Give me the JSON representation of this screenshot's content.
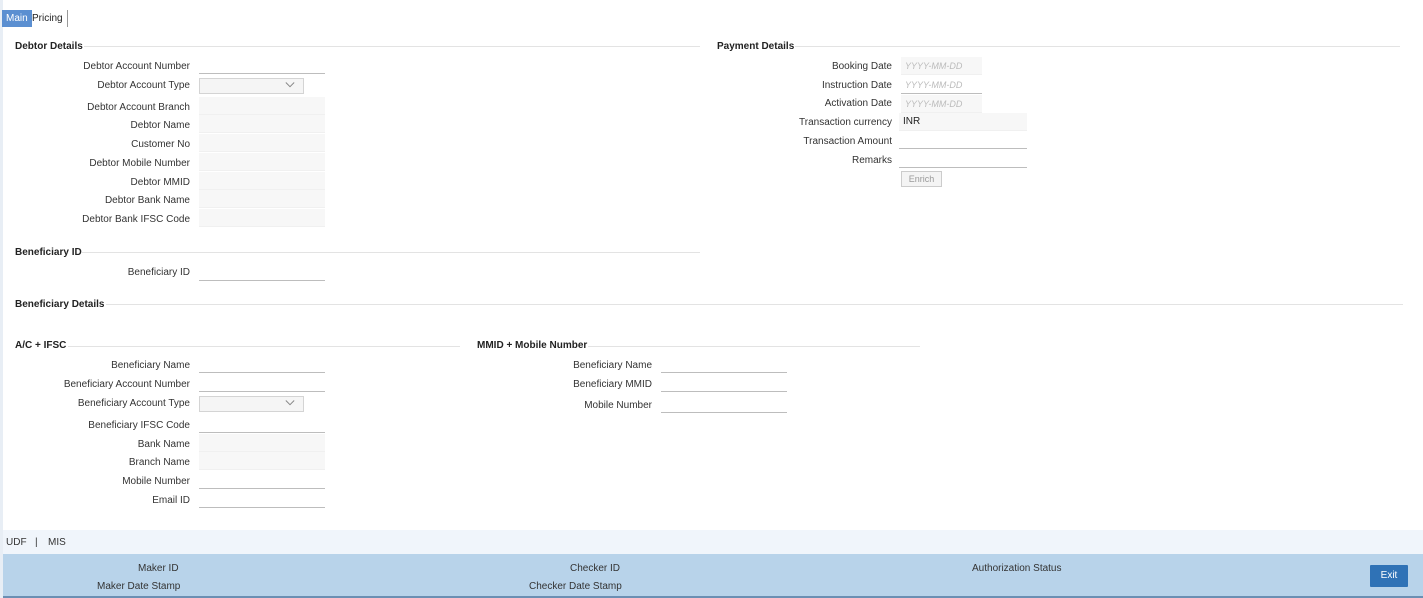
{
  "tabs": {
    "main": "Main",
    "pricing": "Pricing"
  },
  "debtor": {
    "title": "Debtor Details",
    "account_number": "Debtor Account Number",
    "account_type": "Debtor Account Type",
    "account_branch": "Debtor Account Branch",
    "name": "Debtor Name",
    "customer_no": "Customer No",
    "mobile": "Debtor Mobile Number",
    "mmid": "Debtor MMID",
    "bank_name": "Debtor Bank Name",
    "ifsc": "Debtor Bank IFSC Code"
  },
  "payment": {
    "title": "Payment Details",
    "booking_date": "Booking Date",
    "instruction_date": "Instruction Date",
    "activation_date": "Activation Date",
    "currency": "Transaction currency",
    "currency_value": "INR",
    "amount": "Transaction Amount",
    "remarks": "Remarks",
    "date_placeholder": "YYYY-MM-DD",
    "enrich": "Enrich"
  },
  "beneficiary_id": {
    "title": "Beneficiary ID",
    "label": "Beneficiary ID"
  },
  "beneficiary_details": {
    "title": "Beneficiary Details"
  },
  "acifsc": {
    "title": "A/C + IFSC",
    "name": "Beneficiary Name",
    "account_number": "Beneficiary Account Number",
    "account_type": "Beneficiary Account Type",
    "ifsc": "Beneficiary IFSC Code",
    "bank_name": "Bank Name",
    "branch_name": "Branch Name",
    "mobile": "Mobile Number",
    "email": "Email ID"
  },
  "mmid": {
    "title": "MMID + Mobile Number",
    "name": "Beneficiary Name",
    "mmid": "Beneficiary MMID",
    "mobile": "Mobile Number"
  },
  "bottom": {
    "udf": "UDF",
    "separator": "|",
    "mis": "MIS"
  },
  "footer": {
    "maker_id": "Maker ID",
    "maker_date": "Maker Date Stamp",
    "checker_id": "Checker ID",
    "checker_date": "Checker Date Stamp",
    "auth_status": "Authorization Status",
    "exit": "Exit"
  },
  "colors": {
    "accent": "#5b8fd1",
    "footer": "#b8d3ea",
    "exit": "#2f72b6"
  }
}
